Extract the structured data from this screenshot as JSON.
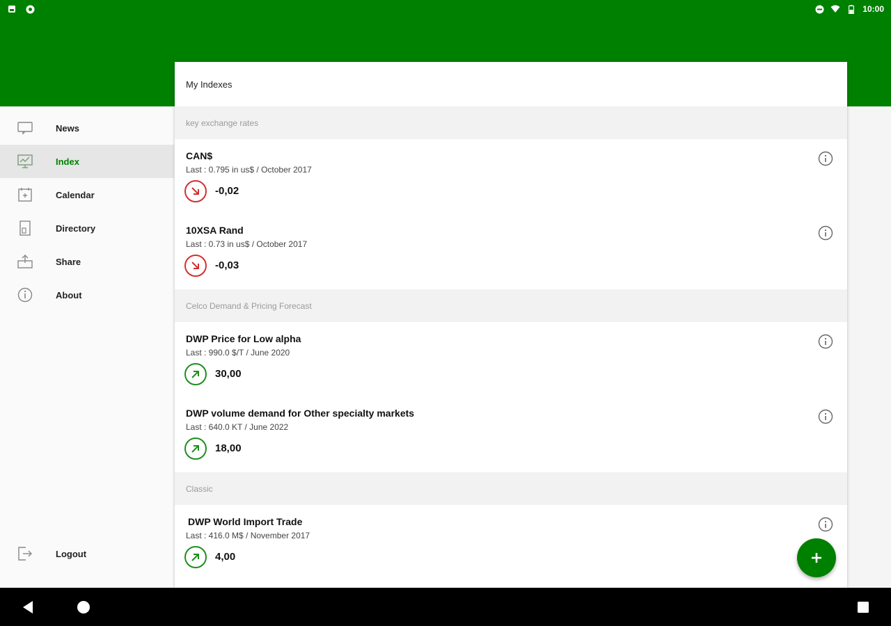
{
  "status_bar": {
    "time": "10:00"
  },
  "sidebar": {
    "items": [
      {
        "label": "News",
        "icon": "news-icon"
      },
      {
        "label": "Index",
        "icon": "index-chart-icon"
      },
      {
        "label": "Calendar",
        "icon": "calendar-icon"
      },
      {
        "label": "Directory",
        "icon": "directory-icon"
      },
      {
        "label": "Share",
        "icon": "share-icon"
      },
      {
        "label": "About",
        "icon": "info-icon"
      }
    ],
    "logout_label": "Logout"
  },
  "main": {
    "title": "My Indexes",
    "sections": [
      {
        "title": "key exchange rates",
        "items": [
          {
            "name": "CAN$",
            "last": "Last : 0.795 in us$ / October 2017",
            "value": "-0,02",
            "trend": "down"
          },
          {
            "name": "10XSA Rand",
            "last": "Last : 0.73 in us$ / October 2017",
            "value": "-0,03",
            "trend": "down"
          }
        ]
      },
      {
        "title": "Celco Demand & Pricing Forecast",
        "items": [
          {
            "name": "DWP Price for Low alpha",
            "last": "Last : 990.0 $/T / June 2020",
            "value": "30,00",
            "trend": "up"
          },
          {
            "name": "DWP volume demand for Other specialty markets",
            "last": "Last : 640.0 KT / June 2022",
            "value": "18,00",
            "trend": "up"
          }
        ]
      },
      {
        "title": "Classic",
        "items": [
          {
            "name": "DWP World Import Trade",
            "last": "Last : 416.0 M$ / November 2017",
            "value": "4,00",
            "trend": "up"
          }
        ]
      }
    ]
  },
  "colors": {
    "brand": "#008000",
    "up": "#1e8e1e",
    "down": "#d32f2f"
  }
}
